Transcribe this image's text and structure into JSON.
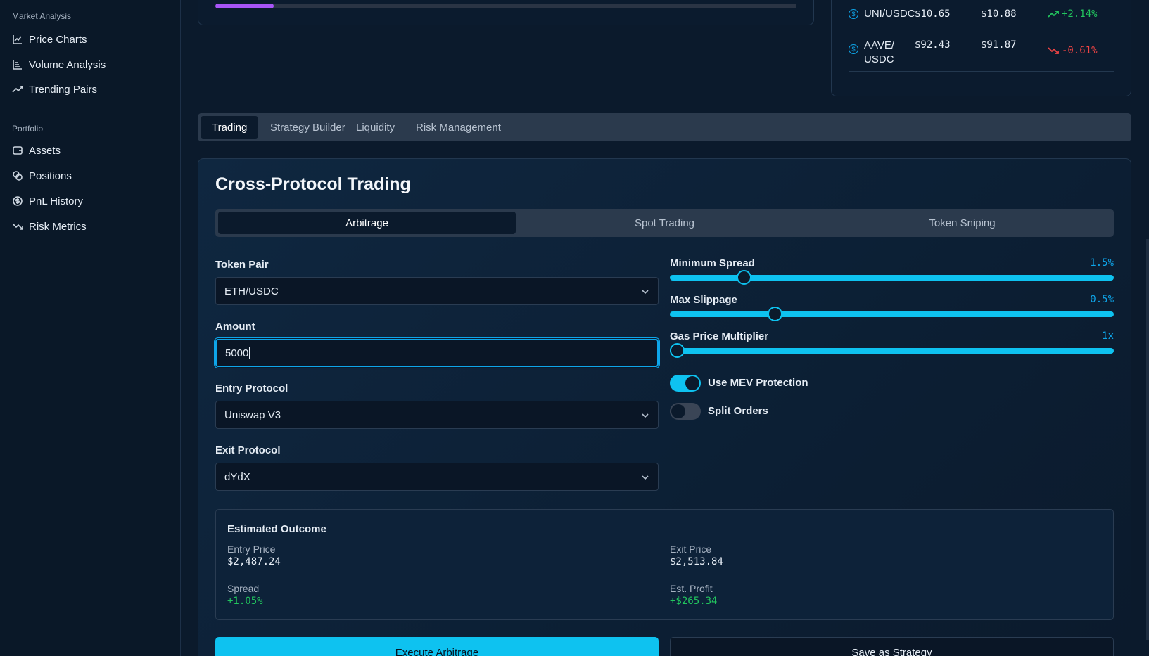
{
  "sidebar": {
    "market_section": "Market Analysis",
    "market_items": [
      {
        "label": "Price Charts",
        "icon": "line-chart-icon"
      },
      {
        "label": "Volume Analysis",
        "icon": "bar-chart-icon"
      },
      {
        "label": "Trending Pairs",
        "icon": "trending-up-icon"
      }
    ],
    "portfolio_section": "Portfolio",
    "portfolio_items": [
      {
        "label": "Assets",
        "icon": "wallet-icon"
      },
      {
        "label": "Positions",
        "icon": "coins-icon"
      },
      {
        "label": "PnL History",
        "icon": "dollar-circle-icon"
      },
      {
        "label": "Risk Metrics",
        "icon": "trending-down-icon"
      }
    ]
  },
  "progress": {
    "fill_percent": 10,
    "color": "#a855f7"
  },
  "markets": [
    {
      "pair": "UNI/USDC",
      "price1": "$10.65",
      "price2": "$10.88",
      "change": "+2.14%",
      "direction": "up"
    },
    {
      "pair": "AAVE/\nUSDC",
      "price1": "$92.43",
      "price2": "$91.87",
      "change": "-0.61%",
      "direction": "down"
    }
  ],
  "tabs": [
    "Trading",
    "Strategy Builder",
    "Liquidity",
    "Risk Management"
  ],
  "panel": {
    "title": "Cross-Protocol Trading",
    "subtabs": [
      "Arbitrage",
      "Spot Trading",
      "Token Sniping"
    ],
    "token_pair_label": "Token Pair",
    "token_pair_value": "ETH/USDC",
    "amount_label": "Amount",
    "amount_value": "5000",
    "entry_label": "Entry Protocol",
    "entry_value": "Uniswap V3",
    "exit_label": "Exit Protocol",
    "exit_value": "dYdX",
    "sliders": [
      {
        "label": "Minimum Spread",
        "value": "1.5%",
        "fraction": 0.15
      },
      {
        "label": "Max Slippage",
        "value": "0.5%",
        "fraction": 0.22
      },
      {
        "label": "Gas Price Multiplier",
        "value": "1x",
        "fraction": 0.0
      }
    ],
    "toggles": [
      {
        "label": "Use MEV Protection",
        "on": true
      },
      {
        "label": "Split Orders",
        "on": false
      }
    ],
    "outcome": {
      "title": "Estimated Outcome",
      "entry_price_label": "Entry Price",
      "entry_price": "$2,487.24",
      "exit_price_label": "Exit Price",
      "exit_price": "$2,513.84",
      "spread_label": "Spread",
      "spread": "+1.05%",
      "profit_label": "Est. Profit",
      "profit": "+$265.34"
    },
    "execute_label": "Execute Arbitrage",
    "save_label": "Save as Strategy"
  },
  "colors": {
    "accent": "#0ec2f0",
    "positive": "#22c55e",
    "negative": "#ef4444",
    "background": "#0b1a2c"
  }
}
